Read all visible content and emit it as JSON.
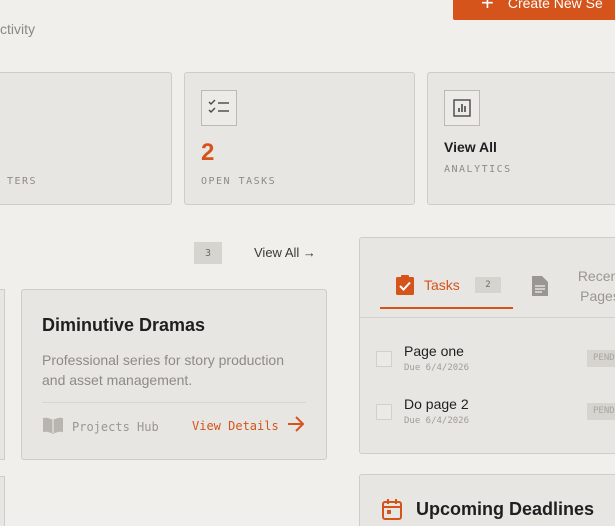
{
  "header": {
    "subtitle": "ctivity",
    "create_button_label": "Create New Se"
  },
  "stats": [
    {
      "value": "",
      "caption": "TERS"
    },
    {
      "value": "2",
      "caption": "OPEN TASKS",
      "icon": "checklist-icon"
    },
    {
      "value": "View All",
      "caption": "ANALYTICS",
      "icon": "bar-chart-icon"
    }
  ],
  "projects": {
    "count": "3",
    "view_all": "View All →",
    "card": {
      "title": "Diminutive Dramas",
      "description": "Professional series for story production and asset management.",
      "hub_label": "Projects Hub",
      "details_label": "View Details"
    }
  },
  "tasks_panel": {
    "tabs": {
      "tasks": {
        "label": "Tasks",
        "count": "2"
      },
      "recent": {
        "label": "Recent Pages"
      }
    },
    "items": [
      {
        "name": "Page one",
        "due": "Due 6/4/2026",
        "status": "PENDING"
      },
      {
        "name": "Do page 2",
        "due": "Due 6/4/2026",
        "status": "PENDING"
      }
    ]
  },
  "deadlines": {
    "title": "Upcoming Deadlines"
  },
  "colors": {
    "accent": "#d4541c",
    "background": "#f1efeb",
    "card": "#e8e6e2"
  }
}
